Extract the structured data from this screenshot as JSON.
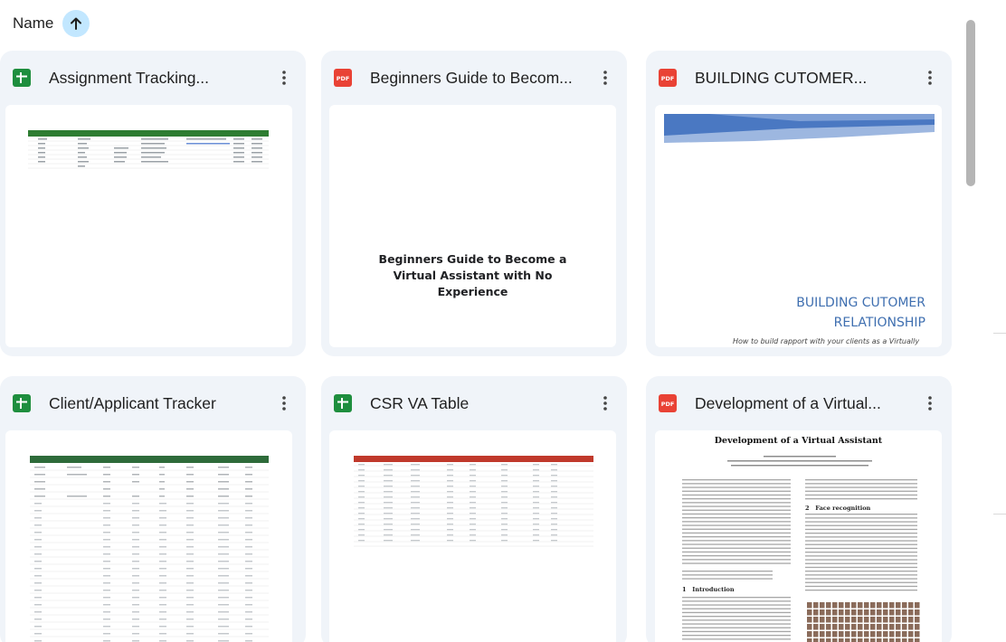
{
  "sort": {
    "label": "Name",
    "icon": "arrow-up-icon"
  },
  "cards": [
    {
      "type": "sheet",
      "title": "Assignment Tracking...",
      "icon": "sheets-icon"
    },
    {
      "type": "pdf",
      "title": "Beginners Guide to Becom...",
      "icon": "pdf-icon",
      "preview": {
        "lines": [
          "Beginners Guide to Become a",
          "Virtual Assistant with No",
          "Experience"
        ]
      }
    },
    {
      "type": "pdf",
      "title": "BUILDING CUTOMER...",
      "icon": "pdf-icon",
      "preview": {
        "title_lines": [
          "BUILDING CUTOMER",
          "RELATIONSHIP"
        ],
        "subtitle": "How to build rapport with your clients as a Virtually"
      }
    },
    {
      "type": "sheet",
      "title": "Client/Applicant Tracker",
      "icon": "sheets-icon"
    },
    {
      "type": "sheet",
      "title": "CSR VA Table",
      "icon": "sheets-icon"
    },
    {
      "type": "pdf",
      "title": "Development of a Virtual...",
      "icon": "pdf-icon",
      "preview": {
        "title": "Development of a Virtual Assistant",
        "sections": [
          "1   Introduction",
          "2   Face recognition"
        ]
      }
    }
  ],
  "colors": {
    "sheet_green": "#1e8e3e",
    "pdf_red": "#e94235",
    "card_bg": "#f0f4f9",
    "sort_accent": "#c2e7ff"
  }
}
